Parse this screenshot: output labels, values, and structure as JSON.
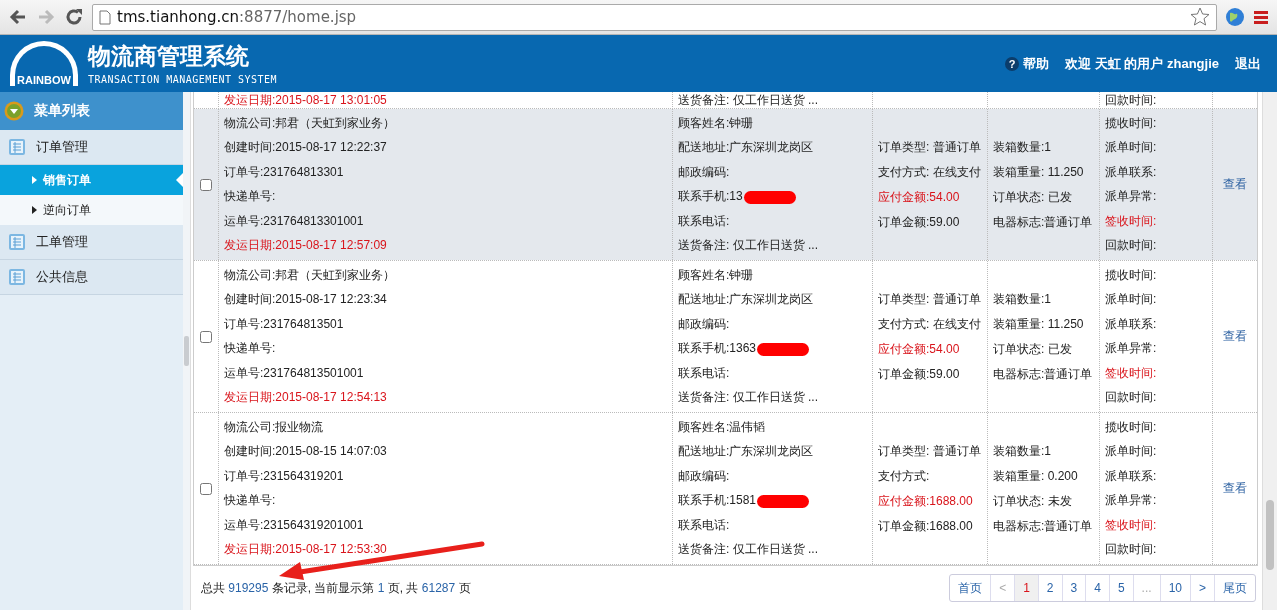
{
  "browser": {
    "url_host": "tms.tianhong.cn",
    "url_path": ":8877/home.jsp",
    "back_disabled": false,
    "forward_disabled": true
  },
  "header": {
    "logo_text": "RAINBOW",
    "title": "物流商管理系统",
    "subtitle": "TRANSACTION MANAGEMENT SYSTEM",
    "help_icon": "?",
    "help": "帮助",
    "welcome": "欢迎 天虹 的用户 zhangjie",
    "logout": "退出"
  },
  "sidebar": {
    "title": "菜单列表",
    "items": [
      {
        "label": "订单管理",
        "children": [
          {
            "label": "销售订单",
            "selected": true
          },
          {
            "label": "逆向订单",
            "selected": false
          }
        ]
      },
      {
        "label": "工单管理"
      },
      {
        "label": "公共信息"
      }
    ]
  },
  "table": {
    "partial_row": {
      "col1": [
        {
          "text": "发运日期:2015-08-17 13:01:05",
          "alert": true
        }
      ],
      "col2": [
        {
          "text": "送货备注: 仅工作日送货 ...",
          "alert": false
        }
      ],
      "col5": [
        {
          "text": "回款时间:",
          "alert": false
        }
      ]
    },
    "rows": [
      {
        "selected": true,
        "checked": false,
        "action": "查看",
        "col1": [
          {
            "text": "物流公司:邦君（天虹到家业务）",
            "alert": false
          },
          {
            "text": "创建时间:2015-08-17 12:22:37",
            "alert": false
          },
          {
            "text": "订单号:231764813301",
            "alert": false
          },
          {
            "text": "快递单号:",
            "alert": false
          },
          {
            "text": "运单号:231764813301001",
            "alert": false
          },
          {
            "text": "发运日期:2015-08-17 12:57:09",
            "alert": true
          }
        ],
        "col2": [
          {
            "text": "顾客姓名:钟珊",
            "alert": false
          },
          {
            "text": "配送地址:广东深圳龙岗区",
            "alert": false
          },
          {
            "text": "邮政编码:",
            "alert": false
          },
          {
            "text": "联系手机:13",
            "alert": false,
            "redacted": true
          },
          {
            "text": "联系电话:",
            "alert": false
          },
          {
            "text": "送货备注: 仅工作日送货 ...",
            "alert": false
          }
        ],
        "col3": [
          {
            "text": "订单类型: 普通订单",
            "alert": false
          },
          {
            "text": "支付方式: 在线支付",
            "alert": false
          },
          {
            "text": "应付金额:54.00",
            "alert": true
          },
          {
            "text": "订单金额:59.00",
            "alert": false
          }
        ],
        "col4": [
          {
            "text": "装箱数量:1",
            "alert": false
          },
          {
            "text": "装箱重量: 11.250",
            "alert": false
          },
          {
            "text": "订单状态: 已发",
            "alert": false
          },
          {
            "text": "电器标志:普通订单",
            "alert": false
          }
        ],
        "col5": [
          {
            "text": "揽收时间:",
            "alert": false
          },
          {
            "text": "派单时间:",
            "alert": false
          },
          {
            "text": "派单联系:",
            "alert": false
          },
          {
            "text": "派单异常:",
            "alert": false
          },
          {
            "text": "签收时间:",
            "alert": true
          },
          {
            "text": "回款时间:",
            "alert": false
          }
        ]
      },
      {
        "selected": false,
        "checked": false,
        "action": "查看",
        "col1": [
          {
            "text": "物流公司:邦君（天虹到家业务）",
            "alert": false
          },
          {
            "text": "创建时间:2015-08-17 12:23:34",
            "alert": false
          },
          {
            "text": "订单号:231764813501",
            "alert": false
          },
          {
            "text": "快递单号:",
            "alert": false
          },
          {
            "text": "运单号:231764813501001",
            "alert": false
          },
          {
            "text": "发运日期:2015-08-17 12:54:13",
            "alert": true
          }
        ],
        "col2": [
          {
            "text": "顾客姓名:钟珊",
            "alert": false
          },
          {
            "text": "配送地址:广东深圳龙岗区",
            "alert": false
          },
          {
            "text": "邮政编码:",
            "alert": false
          },
          {
            "text": "联系手机:1363",
            "alert": false,
            "redacted": true
          },
          {
            "text": "联系电话:",
            "alert": false
          },
          {
            "text": "送货备注: 仅工作日送货 ...",
            "alert": false
          }
        ],
        "col3": [
          {
            "text": "订单类型: 普通订单",
            "alert": false
          },
          {
            "text": "支付方式: 在线支付",
            "alert": false
          },
          {
            "text": "应付金额:54.00",
            "alert": true
          },
          {
            "text": "订单金额:59.00",
            "alert": false
          }
        ],
        "col4": [
          {
            "text": "装箱数量:1",
            "alert": false
          },
          {
            "text": "装箱重量: 11.250",
            "alert": false
          },
          {
            "text": "订单状态: 已发",
            "alert": false
          },
          {
            "text": "电器标志:普通订单",
            "alert": false
          }
        ],
        "col5": [
          {
            "text": "揽收时间:",
            "alert": false
          },
          {
            "text": "派单时间:",
            "alert": false
          },
          {
            "text": "派单联系:",
            "alert": false
          },
          {
            "text": "派单异常:",
            "alert": false
          },
          {
            "text": "签收时间:",
            "alert": true
          },
          {
            "text": "回款时间:",
            "alert": false
          }
        ]
      },
      {
        "selected": false,
        "checked": false,
        "action": "查看",
        "col1": [
          {
            "text": "物流公司:报业物流",
            "alert": false
          },
          {
            "text": "创建时间:2015-08-15 14:07:03",
            "alert": false
          },
          {
            "text": "订单号:231564319201",
            "alert": false
          },
          {
            "text": "快递单号:",
            "alert": false
          },
          {
            "text": "运单号:231564319201001",
            "alert": false
          },
          {
            "text": "发运日期:2015-08-17 12:53:30",
            "alert": true
          }
        ],
        "col2": [
          {
            "text": "顾客姓名:温伟韬",
            "alert": false
          },
          {
            "text": "配送地址:广东深圳龙岗区",
            "alert": false
          },
          {
            "text": "邮政编码:",
            "alert": false
          },
          {
            "text": "联系手机:1581",
            "alert": false,
            "redacted": true
          },
          {
            "text": "联系电话:",
            "alert": false
          },
          {
            "text": "送货备注: 仅工作日送货 ...",
            "alert": false
          }
        ],
        "col3": [
          {
            "text": "订单类型: 普通订单",
            "alert": false
          },
          {
            "text": "支付方式:",
            "alert": false
          },
          {
            "text": "应付金额:1688.00",
            "alert": true
          },
          {
            "text": "订单金额:1688.00",
            "alert": false
          }
        ],
        "col4": [
          {
            "text": "装箱数量:1",
            "alert": false
          },
          {
            "text": "装箱重量: 0.200",
            "alert": false
          },
          {
            "text": "订单状态: 未发",
            "alert": false
          },
          {
            "text": "电器标志:普通订单",
            "alert": false
          }
        ],
        "col5": [
          {
            "text": "揽收时间:",
            "alert": false
          },
          {
            "text": "派单时间:",
            "alert": false
          },
          {
            "text": "派单联系:",
            "alert": false
          },
          {
            "text": "派单异常:",
            "alert": false
          },
          {
            "text": "签收时间:",
            "alert": true
          },
          {
            "text": "回款时间:",
            "alert": false
          }
        ]
      }
    ]
  },
  "footer": {
    "parts": [
      {
        "text": "总共",
        "kind": "plain"
      },
      {
        "text": "919295",
        "kind": "number"
      },
      {
        "text": "条记录, 当前显示第",
        "kind": "plain"
      },
      {
        "text": "1",
        "kind": "number"
      },
      {
        "text": "页, 共",
        "kind": "plain"
      },
      {
        "text": "61287",
        "kind": "number"
      },
      {
        "text": "页",
        "kind": "plain"
      }
    ]
  },
  "pager": [
    {
      "label": "首页",
      "selected": false,
      "disabled": false
    },
    {
      "label": "<",
      "selected": false,
      "disabled": true
    },
    {
      "label": "1",
      "selected": true,
      "disabled": false
    },
    {
      "label": "2",
      "selected": false,
      "disabled": false
    },
    {
      "label": "3",
      "selected": false,
      "disabled": false
    },
    {
      "label": "4",
      "selected": false,
      "disabled": false
    },
    {
      "label": "5",
      "selected": false,
      "disabled": false
    },
    {
      "label": "...",
      "selected": false,
      "disabled": true
    },
    {
      "label": "10",
      "selected": false,
      "disabled": false
    },
    {
      "label": ">",
      "selected": false,
      "disabled": false
    },
    {
      "label": "尾页",
      "selected": false,
      "disabled": false
    }
  ]
}
